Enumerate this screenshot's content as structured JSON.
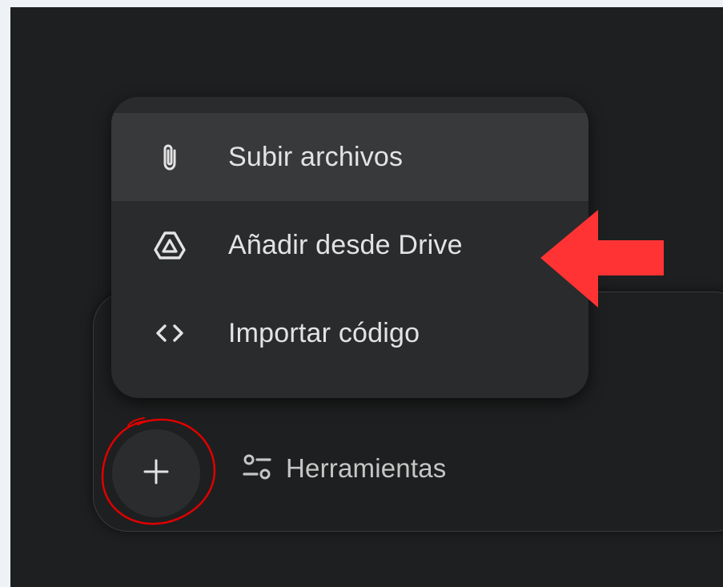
{
  "menu": {
    "items": [
      {
        "label": "Subir archivos",
        "icon": "paperclip-icon",
        "highlighted": true
      },
      {
        "label": "Añadir desde Drive",
        "icon": "google-drive-icon",
        "highlighted": false
      },
      {
        "label": "Importar código",
        "icon": "code-brackets-icon",
        "highlighted": false
      }
    ]
  },
  "toolbar": {
    "plus_icon": "plus-icon",
    "tools_label": "Herramientas",
    "tools_icon": "tune-sliders-icon"
  },
  "annotations": {
    "arrow_color": "#ff3333",
    "circle_color": "#e00000"
  },
  "colors": {
    "background": "#1e1f20",
    "menu_surface": "#2a2b2d",
    "highlight": "#38393b",
    "text_primary": "#e3e3e3",
    "text_secondary": "#c4c7c5"
  }
}
